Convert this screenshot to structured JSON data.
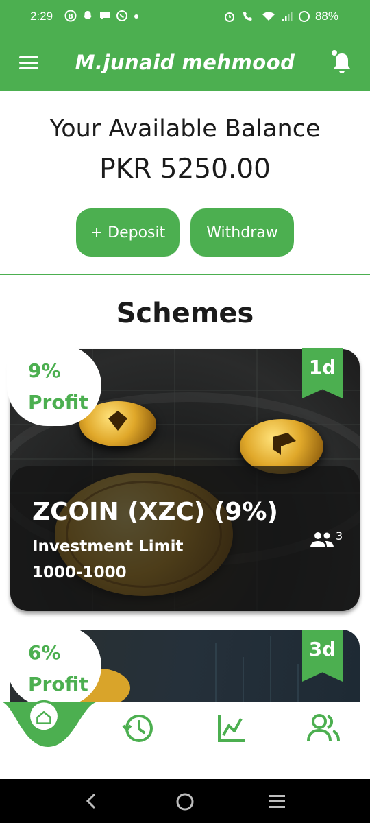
{
  "status_bar": {
    "time": "2:29",
    "battery": "88%",
    "icons_left": [
      "b-circle-icon",
      "snapchat-icon",
      "chat-bubble-icon",
      "whatsapp-icon",
      "dot-icon"
    ],
    "icons_right": [
      "alarm-icon",
      "wifi-call-icon",
      "wifi-icon",
      "signal-icon",
      "battery-ring-icon"
    ]
  },
  "app_bar": {
    "title": "M.junaid mehmood",
    "menu_icon": "hamburger-menu-icon",
    "notification_icon": "bell-icon"
  },
  "balance": {
    "title": "Your Available Balance",
    "amount": "PKR 5250.00"
  },
  "actions": {
    "deposit_label": "+ Deposit",
    "withdraw_label": "Withdraw"
  },
  "schemes_title": "Schemes",
  "schemes": [
    {
      "profit_pct": "9%",
      "profit_label": "Profit",
      "duration": "1d",
      "name": "ZCOIN (XZC) (9%)",
      "limit_label": "Investment Limit",
      "limit_value": "1000-1000",
      "users": "3"
    },
    {
      "profit_pct": "6%",
      "profit_label": "Profit",
      "duration": "3d"
    }
  ],
  "bottom_nav": [
    "home-icon",
    "history-icon",
    "chart-icon",
    "team-icon"
  ],
  "colors": {
    "primary": "#4caf50",
    "text": "#1b1b1b"
  }
}
